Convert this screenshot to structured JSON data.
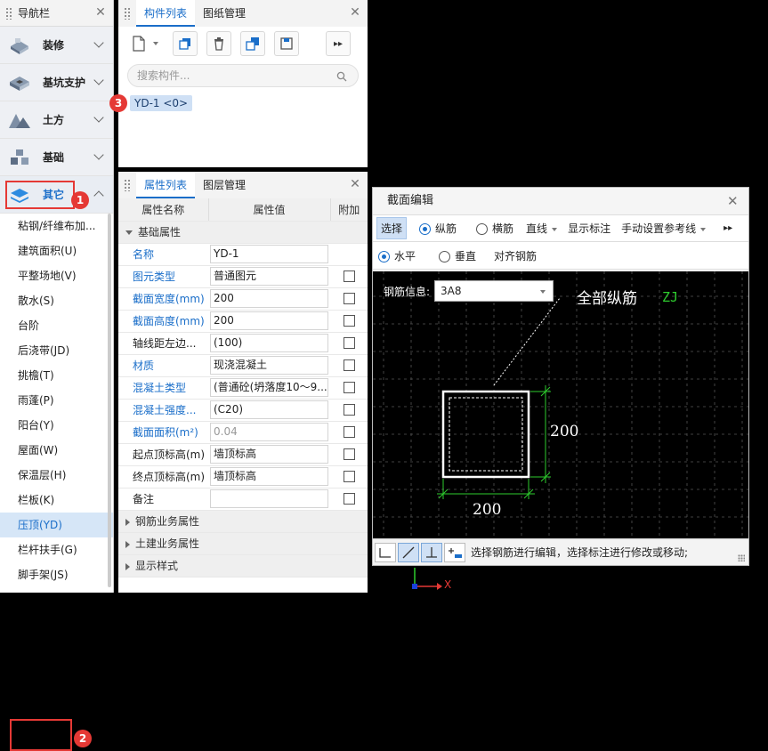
{
  "nav": {
    "title": "导航栏",
    "categories": [
      {
        "label": "装修"
      },
      {
        "label": "基坑支护"
      },
      {
        "label": "土方"
      },
      {
        "label": "基础"
      },
      {
        "label": "其它"
      }
    ],
    "items": [
      "粘钢/纤维布加...",
      "建筑面积(U)",
      "平整场地(V)",
      "散水(S)",
      "台阶",
      "后浇带(JD)",
      "挑檐(T)",
      "雨蓬(P)",
      "阳台(Y)",
      "屋面(W)",
      "保温层(H)",
      "栏板(K)",
      "压顶(YD)",
      "栏杆扶手(G)",
      "脚手架(JS)"
    ],
    "badge1": "1",
    "badge2": "2"
  },
  "components": {
    "tab_active": "构件列表",
    "tab_other": "图纸管理",
    "search_placeholder": "搜索构件...",
    "item": "YD-1 <0>",
    "badge3": "3"
  },
  "properties": {
    "tab_active": "属性列表",
    "tab_other": "图层管理",
    "headers": [
      "属性名称",
      "属性值",
      "附加"
    ],
    "group_basic": "基础属性",
    "rows": [
      {
        "name": "名称",
        "value": "YD-1",
        "blue": true,
        "check": false
      },
      {
        "name": "图元类型",
        "value": "普通图元",
        "blue": true,
        "check": true
      },
      {
        "name": "截面宽度(mm)",
        "value": "200",
        "blue": true,
        "check": true
      },
      {
        "name": "截面高度(mm)",
        "value": "200",
        "blue": true,
        "check": true
      },
      {
        "name": "轴线距左边...",
        "value": "(100)",
        "blue": false,
        "check": true
      },
      {
        "name": "材质",
        "value": "现浇混凝土",
        "blue": true,
        "check": true
      },
      {
        "name": "混凝土类型",
        "value": "(普通砼(坍落度10～9...",
        "blue": true,
        "check": true
      },
      {
        "name": "混凝土强度...",
        "value": "(C20)",
        "blue": true,
        "check": true
      },
      {
        "name": "截面面积(m²)",
        "value": "0.04",
        "blue": true,
        "check": true,
        "grey": true
      },
      {
        "name": "起点顶标高(m)",
        "value": "墙顶标高",
        "blue": false,
        "check": true
      },
      {
        "name": "终点顶标高(m)",
        "value": "墙顶标高",
        "blue": false,
        "check": true
      },
      {
        "name": "备注",
        "value": "",
        "blue": false,
        "check": true
      }
    ],
    "groups_collapsed": [
      "钢筋业务属性",
      "土建业务属性",
      "显示样式"
    ]
  },
  "section_editor": {
    "title": "截面编辑",
    "toolbar1": {
      "select": "选择",
      "longitudinal": "纵筋",
      "transverse": "横筋",
      "line": "直线",
      "show_dim": "显示标注",
      "manual_ref": "手动设置参考线"
    },
    "toolbar2": {
      "horizontal": "水平",
      "vertical": "垂直",
      "align": "对齐钢筋"
    },
    "rebar_label": "钢筋信息:",
    "rebar_value": "3A8",
    "annotation": "全部纵筋",
    "annotation_code": "ZJ",
    "dim_right": "200",
    "dim_bottom": "200",
    "status_text": "选择钢筋进行编辑，选择标注进行修改或移动;",
    "axis_label": "X"
  },
  "colors": {
    "accent": "#1a6ec9",
    "red": "#e53935",
    "green": "#2ecc2e"
  }
}
